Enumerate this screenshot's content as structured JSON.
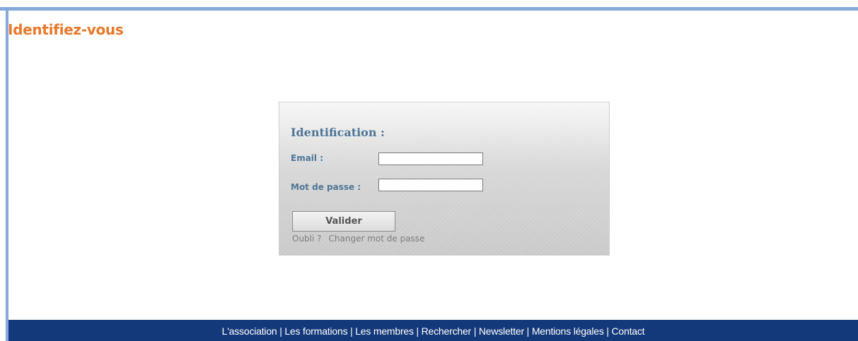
{
  "page": {
    "title": "Identifiez-vous"
  },
  "login": {
    "heading": "Identification :",
    "email_label": "Email :",
    "email_value": "",
    "password_label": "Mot de passe :",
    "password_value": "",
    "submit_label": "Valider",
    "forgot_link": "Oubli ?",
    "change_password_link": "Changer mot de passe"
  },
  "footer": {
    "links": [
      {
        "label": "L'association"
      },
      {
        "label": "Les formations"
      },
      {
        "label": "Les membres"
      },
      {
        "label": "Rechercher"
      },
      {
        "label": "Newsletter"
      },
      {
        "label": "Mentions légales"
      },
      {
        "label": "Contact"
      }
    ],
    "separator": " | "
  },
  "colors": {
    "title_orange": "#e8782a",
    "label_blue": "#4e7596",
    "footer_navy": "#14397a",
    "frame_light_blue": "#86a9dc"
  }
}
